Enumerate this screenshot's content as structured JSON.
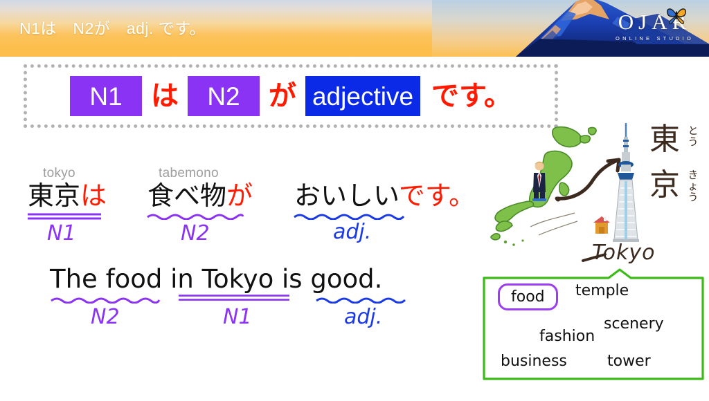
{
  "header": {
    "title": "N1は　N2が　adj. です。",
    "logo_main": "OJAR",
    "logo_sub": "ONLINE STUDIO",
    "icons": {
      "butterfly": "butterfly-icon",
      "mountain": "mount-fuji-illustration"
    },
    "colors": {
      "gradient_top": "#cfd9e8",
      "gradient_bottom": "#fdbe49",
      "text": "#ffffff"
    }
  },
  "pattern": {
    "n1_label": "N1",
    "particle_wa": "は",
    "n2_label": "N2",
    "particle_ga": "が",
    "adjective_label": "adjective",
    "copula": "です。",
    "colors": {
      "noun_chip": "#8b33f5",
      "adjective_chip": "#0a2ae8",
      "particle": "#ff1a00",
      "border": "#b3b3b3"
    }
  },
  "example_jp": {
    "segments": [
      {
        "romaji": "tokyo",
        "word": "東京",
        "particle": "は",
        "role": "N1",
        "underline": "double-straight",
        "underline_color": "#8b33f5"
      },
      {
        "romaji": "tabemono",
        "word": "食べ物",
        "particle": "が",
        "role": "N2",
        "underline": "wavy",
        "underline_color": "#8b33f5"
      },
      {
        "romaji": "",
        "word": "おいしい",
        "particle": "です。",
        "role": "adj.",
        "underline": "wavy",
        "underline_color": "#1a3ae8"
      }
    ]
  },
  "example_en": {
    "full_sentence": "The food in Tokyo is good.",
    "part_1": "The food",
    "part_2": "in Tokyo",
    "part_3": " is ",
    "part_4": "good.",
    "labels": {
      "n2": "N2",
      "n1": "N1",
      "adj": "adj."
    }
  },
  "illustration": {
    "kanji_1": "東",
    "furigana_1": "とう",
    "kanji_2": "京",
    "furigana_2": "きょう",
    "handwritten_place": "Tokyo",
    "icons": {
      "map": "japan-map-icon",
      "tower": "tokyo-skytree-icon",
      "arrow": "curved-arrow-icon",
      "house": "house-icon",
      "person": "businessman-icon"
    }
  },
  "callout": {
    "highlighted_word": "food",
    "words": [
      "temple",
      "scenery",
      "fashion",
      "business",
      "tower"
    ],
    "border_color": "#3cbb18",
    "highlight_color": "#9b3df0"
  }
}
